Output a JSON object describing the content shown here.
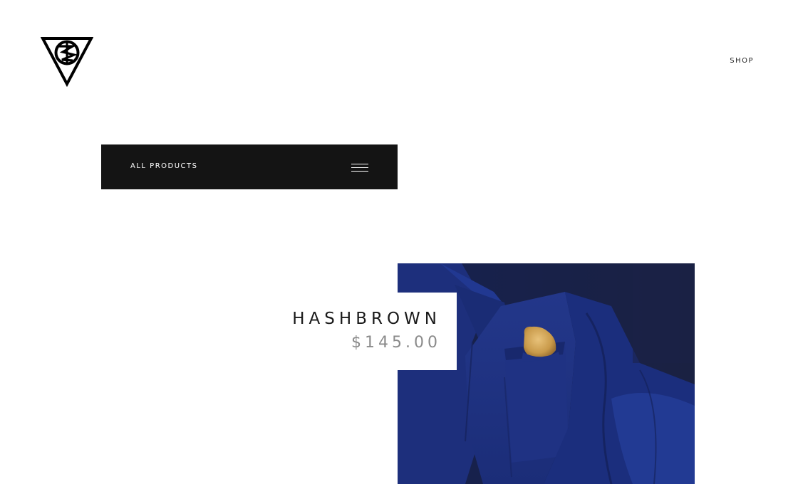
{
  "header": {
    "logo_icon": "triangle-monogram-logo",
    "nav": {
      "shop_label": "SHOP"
    }
  },
  "filter": {
    "label": "ALL PRODUCTS",
    "menu_icon": "hamburger-menu-icon"
  },
  "product": {
    "name": "HASHBROWN",
    "price": "$145.00"
  },
  "colors": {
    "bar_background": "#141414",
    "image_navy": "#1c2a6e",
    "price_gray": "#8a8a8a",
    "text_dark": "#1a1a1a"
  }
}
